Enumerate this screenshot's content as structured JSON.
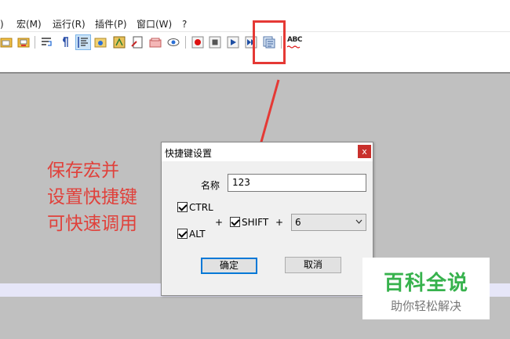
{
  "menu": [
    ")",
    "宏(M)",
    "运行(R)",
    "插件(P)",
    "窗口(W)",
    "?"
  ],
  "toolbar": {
    "icons": [
      "open-file-icon",
      "save-file-icon",
      "word-wrap-icon",
      "pilcrow-icon",
      "indent-guide-icon",
      "folder-view-icon",
      "function-list-icon",
      "document-map-icon",
      "close-all-icon",
      "monitor-eye-icon",
      "record-macro-icon",
      "stop-record-icon",
      "play-macro-icon",
      "run-multiple-icon",
      "save-macro-icon",
      "spellcheck-icon"
    ],
    "spellcheck_label": "ABC"
  },
  "annotation": {
    "lines": [
      "保存宏并",
      "设置快捷键",
      "可快速调用"
    ],
    "color": "#e0413b"
  },
  "dialog": {
    "title": "快捷键设置",
    "close_glyph": "x",
    "name_label": "名称",
    "name_value": "123",
    "ctrl_label": "CTRL",
    "alt_label": "ALT",
    "shift_label": "SHIFT",
    "plus": "+",
    "key_value": "6",
    "ok_label": "确定",
    "cancel_label": "取消"
  },
  "watermark": {
    "main": "百科全说",
    "sub": "助你轻松解决",
    "color": "#37b24d"
  }
}
